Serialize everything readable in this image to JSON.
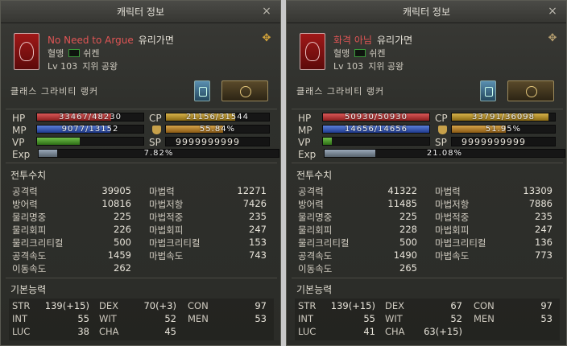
{
  "panels": [
    {
      "title": "캐릭터 정보",
      "close": "×",
      "name": "No Need to Argue",
      "clan": "유리가면",
      "pledge_label": "혈맹",
      "pledge_value": "쉬켄",
      "level": "Lv 103",
      "rank": "지위 공왕",
      "class_name": "클래스 그라비티 랭커",
      "hp": {
        "label": "HP",
        "text": "33467/48230",
        "fraction": 0.694
      },
      "mp": {
        "label": "MP",
        "text": "9077/13152",
        "fraction": 0.69
      },
      "vp": {
        "label": "VP",
        "fraction": 0.4
      },
      "cp": {
        "label": "CP",
        "text": "21156/31544",
        "fraction": 0.671
      },
      "weight": {
        "text": "55.84%",
        "fraction": 0.558
      },
      "sp": {
        "label": "SP",
        "text": "9999999999"
      },
      "exp": {
        "label": "Exp",
        "text": "7.82%",
        "fraction": 0.078
      },
      "combat_title": "전투수치",
      "combat_left": [
        {
          "k": "공격력",
          "v": "39905"
        },
        {
          "k": "방어력",
          "v": "10816"
        },
        {
          "k": "물리명중",
          "v": "225"
        },
        {
          "k": "물리회피",
          "v": "226"
        },
        {
          "k": "물리크리티컬",
          "v": "500"
        },
        {
          "k": "공격속도",
          "v": "1459"
        },
        {
          "k": "이동속도",
          "v": "262"
        }
      ],
      "combat_right": [
        {
          "k": "마법력",
          "v": "12271"
        },
        {
          "k": "마법저항",
          "v": "7426"
        },
        {
          "k": "마법적중",
          "v": "235"
        },
        {
          "k": "마법회피",
          "v": "247"
        },
        {
          "k": "마법크리티컬",
          "v": "153"
        },
        {
          "k": "마법속도",
          "v": "743"
        }
      ],
      "base_title": "기본능력",
      "base": [
        [
          {
            "k": "STR",
            "v": "139(+15)"
          },
          {
            "k": "DEX",
            "v": "70(+3)"
          },
          {
            "k": "CON",
            "v": "97"
          }
        ],
        [
          {
            "k": "INT",
            "v": "55"
          },
          {
            "k": "WIT",
            "v": "52"
          },
          {
            "k": "MEN",
            "v": "53"
          }
        ],
        [
          {
            "k": "LUC",
            "v": "38"
          },
          {
            "k": "CHA",
            "v": "45"
          }
        ]
      ]
    },
    {
      "title": "캐릭터 정보",
      "close": "×",
      "name": "화격 아님",
      "clan": "유리가면",
      "pledge_label": "혈맹",
      "pledge_value": "쉬켄",
      "level": "Lv 103",
      "rank": "지위 공왕",
      "class_name": "클래스 그라비티 랭커",
      "hp": {
        "label": "HP",
        "text": "50930/50930",
        "fraction": 1.0
      },
      "mp": {
        "label": "MP",
        "text": "14656/14656",
        "fraction": 1.0
      },
      "vp": {
        "label": "VP",
        "fraction": 0.08
      },
      "cp": {
        "label": "CP",
        "text": "33791/36098",
        "fraction": 0.936
      },
      "weight": {
        "text": "51.95%",
        "fraction": 0.52
      },
      "sp": {
        "label": "SP",
        "text": "9999999999"
      },
      "exp": {
        "label": "Exp",
        "text": "21.08%",
        "fraction": 0.211
      },
      "combat_title": "전투수치",
      "combat_left": [
        {
          "k": "공격력",
          "v": "41322"
        },
        {
          "k": "방어력",
          "v": "11485"
        },
        {
          "k": "물리명중",
          "v": "225"
        },
        {
          "k": "물리회피",
          "v": "228"
        },
        {
          "k": "물리크리티컬",
          "v": "500"
        },
        {
          "k": "공격속도",
          "v": "1490"
        },
        {
          "k": "이동속도",
          "v": "265"
        }
      ],
      "combat_right": [
        {
          "k": "마법력",
          "v": "13309"
        },
        {
          "k": "마법저항",
          "v": "7886"
        },
        {
          "k": "마법적중",
          "v": "235"
        },
        {
          "k": "마법회피",
          "v": "247"
        },
        {
          "k": "마법크리티컬",
          "v": "136"
        },
        {
          "k": "마법속도",
          "v": "773"
        }
      ],
      "base_title": "기본능력",
      "base": [
        [
          {
            "k": "STR",
            "v": "139(+15)"
          },
          {
            "k": "DEX",
            "v": "67"
          },
          {
            "k": "CON",
            "v": "97"
          }
        ],
        [
          {
            "k": "INT",
            "v": "55"
          },
          {
            "k": "WIT",
            "v": "52"
          },
          {
            "k": "MEN",
            "v": "53"
          }
        ],
        [
          {
            "k": "LUC",
            "v": "41"
          },
          {
            "k": "CHA",
            "v": "63(+15)"
          }
        ]
      ]
    }
  ]
}
